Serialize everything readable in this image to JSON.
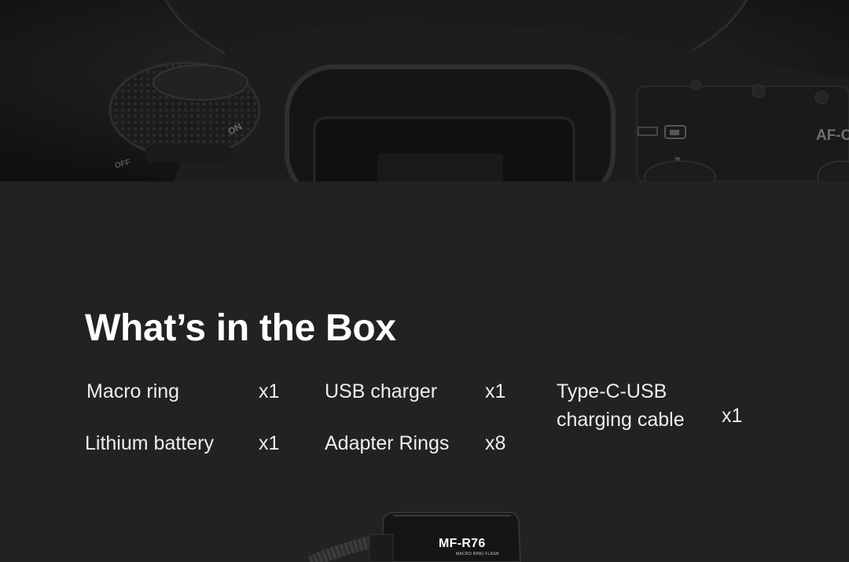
{
  "hero": {
    "dial_text_on": "ON",
    "dial_text_off": "OFF",
    "body_label": "AF-C"
  },
  "section": {
    "title": "What’s in the Box"
  },
  "box_items": [
    {
      "name": "Macro ring",
      "qty": "x1"
    },
    {
      "name": "USB charger",
      "qty": "x1"
    },
    {
      "name_line1": "Type-C-USB",
      "name_line2": "charging cable",
      "qty": "x1"
    },
    {
      "name": "Lithium battery",
      "qty": "x1"
    },
    {
      "name": "Adapter Rings",
      "qty": "x8"
    }
  ],
  "product": {
    "model": "MF-R76",
    "subtitle": "MACRO RING FLASH"
  }
}
